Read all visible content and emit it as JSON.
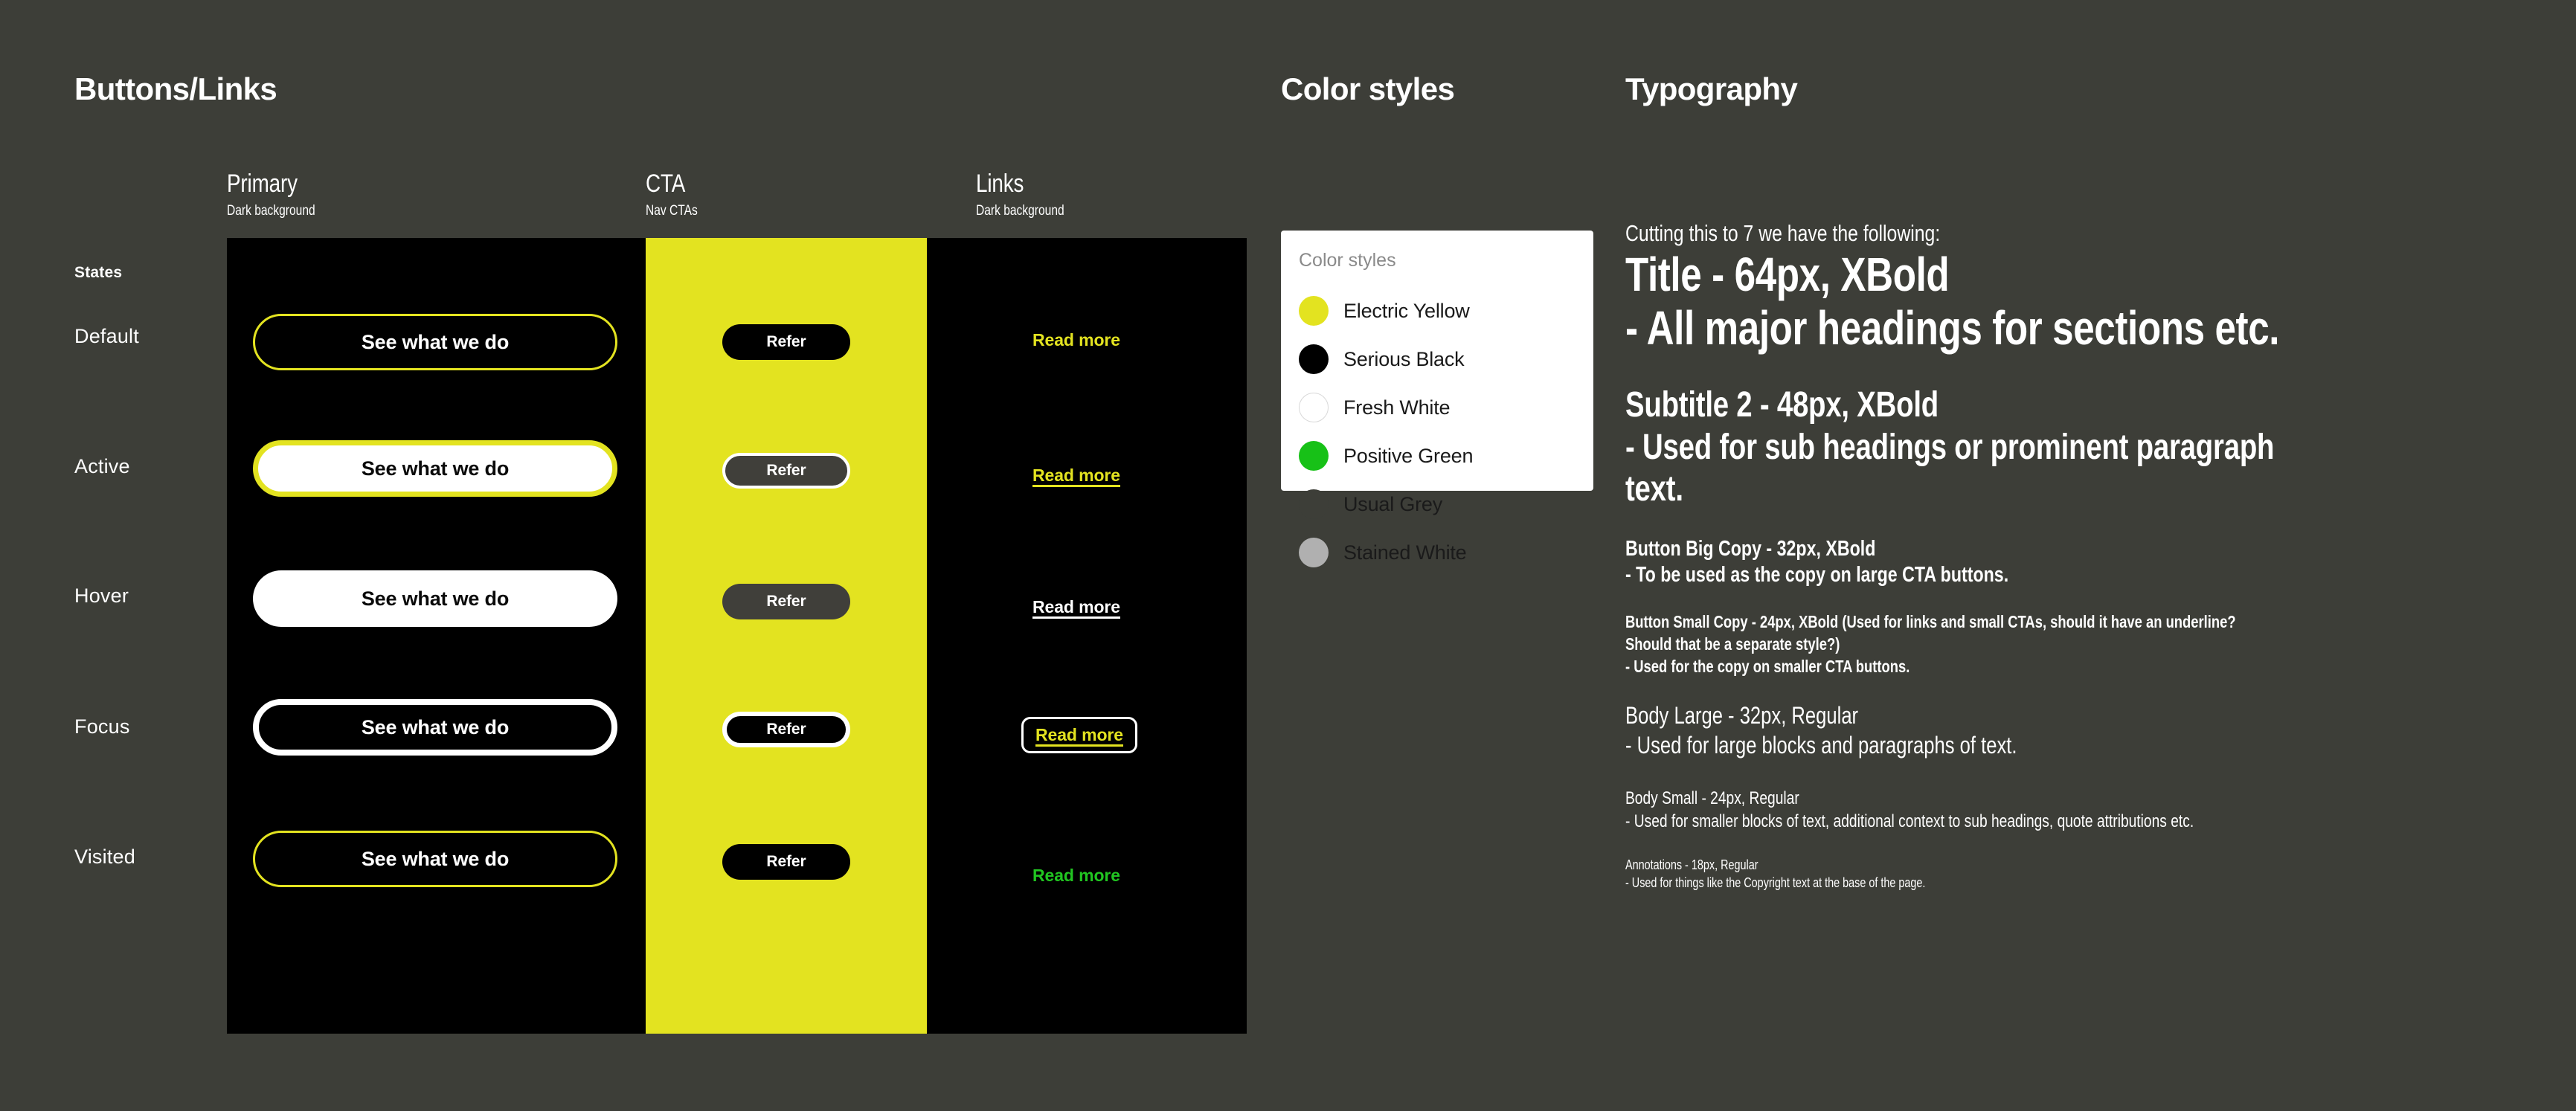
{
  "sections": {
    "buttons_links": "Buttons/Links",
    "color_styles": "Color styles",
    "typography": "Typography"
  },
  "buttons": {
    "states_header": "States",
    "states": [
      "Default",
      "Active",
      "Hover",
      "Focus",
      "Visited"
    ],
    "columns": [
      {
        "name": "Primary",
        "sub": "Dark background"
      },
      {
        "name": "CTA",
        "sub": "Nav CTAs"
      },
      {
        "name": "Links",
        "sub": "Dark background"
      }
    ],
    "primary_label": "See what we do",
    "cta_label": "Refer",
    "link_label": "Read more",
    "primary": [
      {
        "state": "Default",
        "label": "See what we do"
      },
      {
        "state": "Active",
        "label": "See what we do"
      },
      {
        "state": "Hover",
        "label": "See what we do"
      },
      {
        "state": "Focus",
        "label": "See what we do"
      },
      {
        "state": "Visited",
        "label": "See what we do"
      }
    ],
    "cta": [
      {
        "state": "Default",
        "label": "Refer"
      },
      {
        "state": "Active",
        "label": "Refer"
      },
      {
        "state": "Hover",
        "label": "Refer"
      },
      {
        "state": "Focus",
        "label": "Refer"
      },
      {
        "state": "Visited",
        "label": "Refer"
      }
    ],
    "links": [
      {
        "state": "Default",
        "label": "Read more"
      },
      {
        "state": "Active",
        "label": "Read more"
      },
      {
        "state": "Hover",
        "label": "Read more"
      },
      {
        "state": "Focus",
        "label": "Read more"
      },
      {
        "state": "Visited",
        "label": "Read more"
      }
    ]
  },
  "colors_card": {
    "title": "Color styles",
    "swatches": [
      {
        "name": "Electric Yellow",
        "hex": "#e3e320"
      },
      {
        "name": "Serious Black",
        "hex": "#000000"
      },
      {
        "name": "Fresh White",
        "hex": "#ffffff"
      },
      {
        "name": "Positive Green",
        "hex": "#17c117"
      },
      {
        "name": "Usual Grey",
        "hex": "#3d3e38"
      },
      {
        "name": "Stained White",
        "hex": "#b0b0b0"
      }
    ]
  },
  "typography": {
    "intro": "Cutting this to 7 we have the following:",
    "title_name": "Title - 64px, XBold",
    "title_desc": "- All major headings for sections etc.",
    "subtitle2_name": "Subtitle 2 - 48px, XBold",
    "subtitle2_desc_1": "- Used for sub headings or prominent paragraph",
    "subtitle2_desc_2": "text.",
    "button_big_name": "Button Big Copy - 32px, XBold",
    "button_big_desc": "- To be used as the copy on large CTA buttons.",
    "button_small_name_1": "Button Small Copy - 24px, XBold (Used for links and small CTAs, should it have an underline?",
    "button_small_name_2": "Should that be a separate style?)",
    "button_small_desc": "- Used for the copy on smaller CTA buttons.",
    "body_large_name": "Body Large - 32px, Regular",
    "body_large_desc": "- Used for large blocks and paragraphs of text.",
    "body_small_name": "Body Small - 24px, Regular",
    "body_small_desc": "- Used for smaller blocks of text, additional context to sub headings, quote attributions etc.",
    "annotations_name": "Annotations - 18px, Regular",
    "annotations_desc": "- Used for things like the Copyright text at the base of the page."
  },
  "theme": {
    "background": "#3d3e38",
    "accent_yellow": "#e3e320",
    "black": "#000000",
    "white": "#ffffff",
    "green": "#21c521",
    "grey": "#403f3a"
  }
}
